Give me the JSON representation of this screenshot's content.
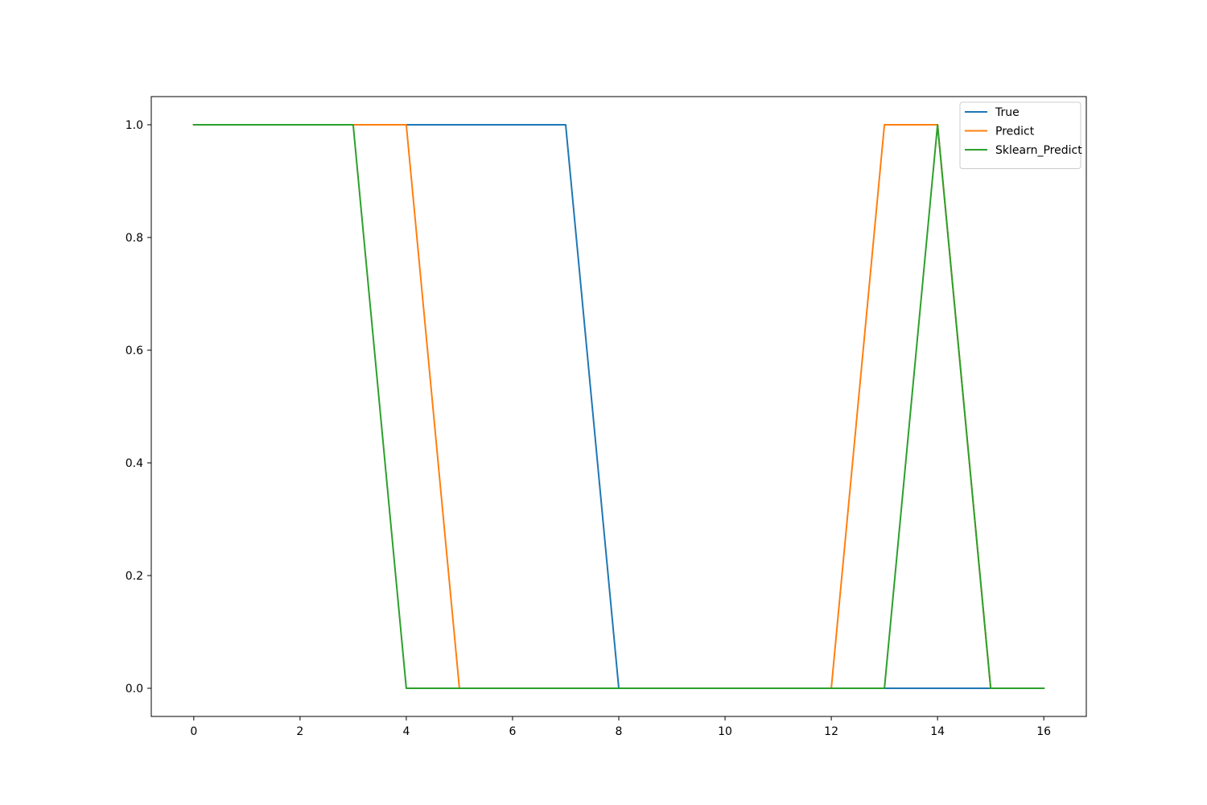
{
  "chart_data": {
    "type": "line",
    "title": "",
    "xlabel": "",
    "ylabel": "",
    "xlim": [
      -0.8,
      16.8
    ],
    "ylim": [
      -0.05,
      1.05
    ],
    "grid": false,
    "legend_position": "top-right",
    "x_ticks": [
      0,
      2,
      4,
      6,
      8,
      10,
      12,
      14,
      16
    ],
    "x_tick_labels": [
      "0",
      "2",
      "4",
      "6",
      "8",
      "10",
      "12",
      "14",
      "16"
    ],
    "y_ticks": [
      0.0,
      0.2,
      0.4,
      0.6,
      0.8,
      1.0
    ],
    "y_tick_labels": [
      "0.0",
      "0.2",
      "0.4",
      "0.6",
      "0.8",
      "1.0"
    ],
    "x": [
      0,
      1,
      2,
      3,
      4,
      5,
      6,
      7,
      8,
      9,
      10,
      11,
      12,
      13,
      14,
      15,
      16
    ],
    "series": [
      {
        "name": "True",
        "color": "#1f77b4",
        "values": [
          1,
          1,
          1,
          1,
          1,
          1,
          1,
          1,
          0,
          0,
          0,
          0,
          0,
          0,
          0,
          0,
          0
        ]
      },
      {
        "name": "Predict",
        "color": "#ff7f0e",
        "values": [
          1,
          1,
          1,
          1,
          1,
          0,
          0,
          0,
          0,
          0,
          0,
          0,
          0,
          1,
          1,
          0,
          0
        ]
      },
      {
        "name": "Sklearn_Predict",
        "color": "#2ca02c",
        "values": [
          1,
          1,
          1,
          1,
          0,
          0,
          0,
          0,
          0,
          0,
          0,
          0,
          0,
          0,
          1,
          0,
          0
        ]
      }
    ]
  }
}
